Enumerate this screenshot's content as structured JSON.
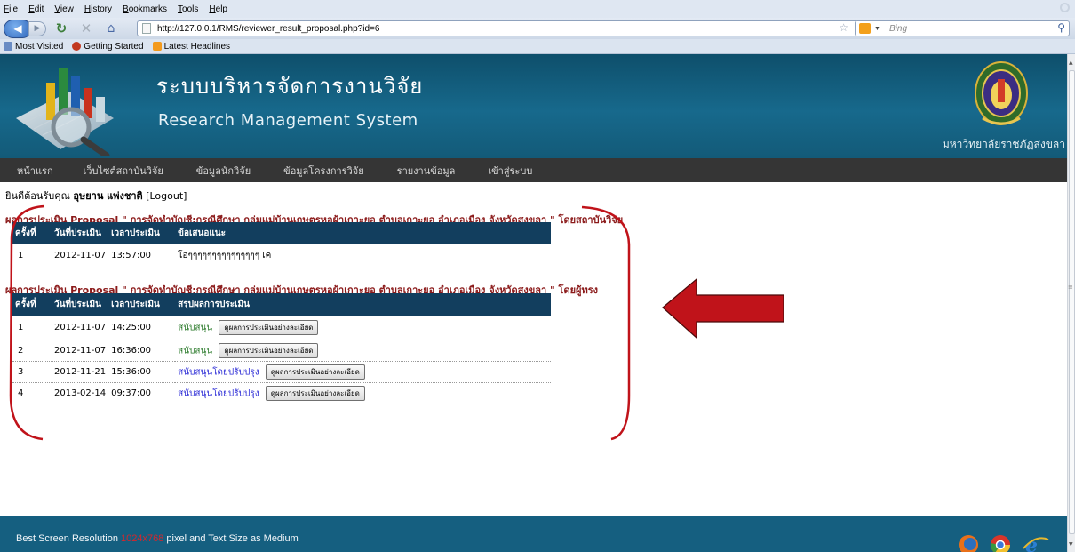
{
  "browser": {
    "menu": [
      "File",
      "Edit",
      "View",
      "History",
      "Bookmarks",
      "Tools",
      "Help"
    ],
    "url": "http://127.0.0.1/RMS/reviewer_result_proposal.php?id=6",
    "search_placeholder": "Bing",
    "bookmarks": [
      "Most Visited",
      "Getting Started",
      "Latest Headlines"
    ]
  },
  "site": {
    "title_th": "ระบบบริหารจัดการงานวิจัย",
    "title_en": "Research Management System",
    "university": "มหาวิทยาลัยราชภัฏสงขลา",
    "nav": [
      "หน้าแรก",
      "เว็บไซต์สถาบันวิจัย",
      "ข้อมูลนักวิจัย",
      "ข้อมูลโครงการวิจัย",
      "รายงานข้อมูล",
      "เข้าสู่ระบบ"
    ]
  },
  "welcome": {
    "prefix": "ยินดีต้อนรับคุณ",
    "user": "อุษยาน แพ่งชาติ",
    "logout": "[Logout]"
  },
  "institute_section": {
    "title": "ผลการประเมิน Proposal \" การจัดทำบัญชี:กรณีศึกษา กลุ่มแม่บ้านเกษตรหอผ้าเกาะยอ ตำบลเกาะยอ อำเภอเมือง จังหวัดสงขลา \" โดยสถาบันวิจัย",
    "headers": [
      "ครั้งที่",
      "วันที่ประเมิน",
      "เวลาประเมิน",
      "ข้อเสนอแนะ"
    ],
    "rows": [
      {
        "no": "1",
        "date": "2012-11-07",
        "time": "13:57:00",
        "comment": "โอๆๆๆๆๆๆๆๆๆๆๆๆๆๆๆ เค"
      }
    ]
  },
  "expert_section": {
    "title": "ผลการประเมิน Proposal \" การจัดทำบัญชี:กรณีศึกษา กลุ่มแม่บ้านเกษตรหอผ้าเกาะยอ ตำบลเกาะยอ อำเภอเมือง จังหวัดสงขลา \" โดยผู้ทรง",
    "headers": [
      "ครั้งที่",
      "วันที่ประเมิน",
      "เวลาประเมิน",
      "สรุปผลการประเมิน"
    ],
    "button_label": "ดูผลการประเมินอย่างละเอียด",
    "rows": [
      {
        "no": "1",
        "date": "2012-11-07",
        "time": "14:25:00",
        "result": "สนับสนุน"
      },
      {
        "no": "2",
        "date": "2012-11-07",
        "time": "16:36:00",
        "result": "สนับสนุน"
      },
      {
        "no": "3",
        "date": "2012-11-21",
        "time": "15:36:00",
        "result": "สนับสนุนโดยปรับปรุง"
      },
      {
        "no": "4",
        "date": "2013-02-14",
        "time": "09:37:00",
        "result": "สนับสนุนโดยปรับปรุง"
      }
    ]
  },
  "footer": {
    "text_before": "Best Screen Resolution",
    "resolution": "1024x768",
    "text_after": "pixel and Text Size as Medium"
  },
  "colors": {
    "header_bg": "#135a78",
    "nav_bg": "#353535",
    "table_header_bg": "#123e5e",
    "section_title": "#8b1a1a",
    "annotation_red": "#c0131a",
    "result_support": "#2a7a2a",
    "result_support_improve": "#2b2bd6"
  }
}
